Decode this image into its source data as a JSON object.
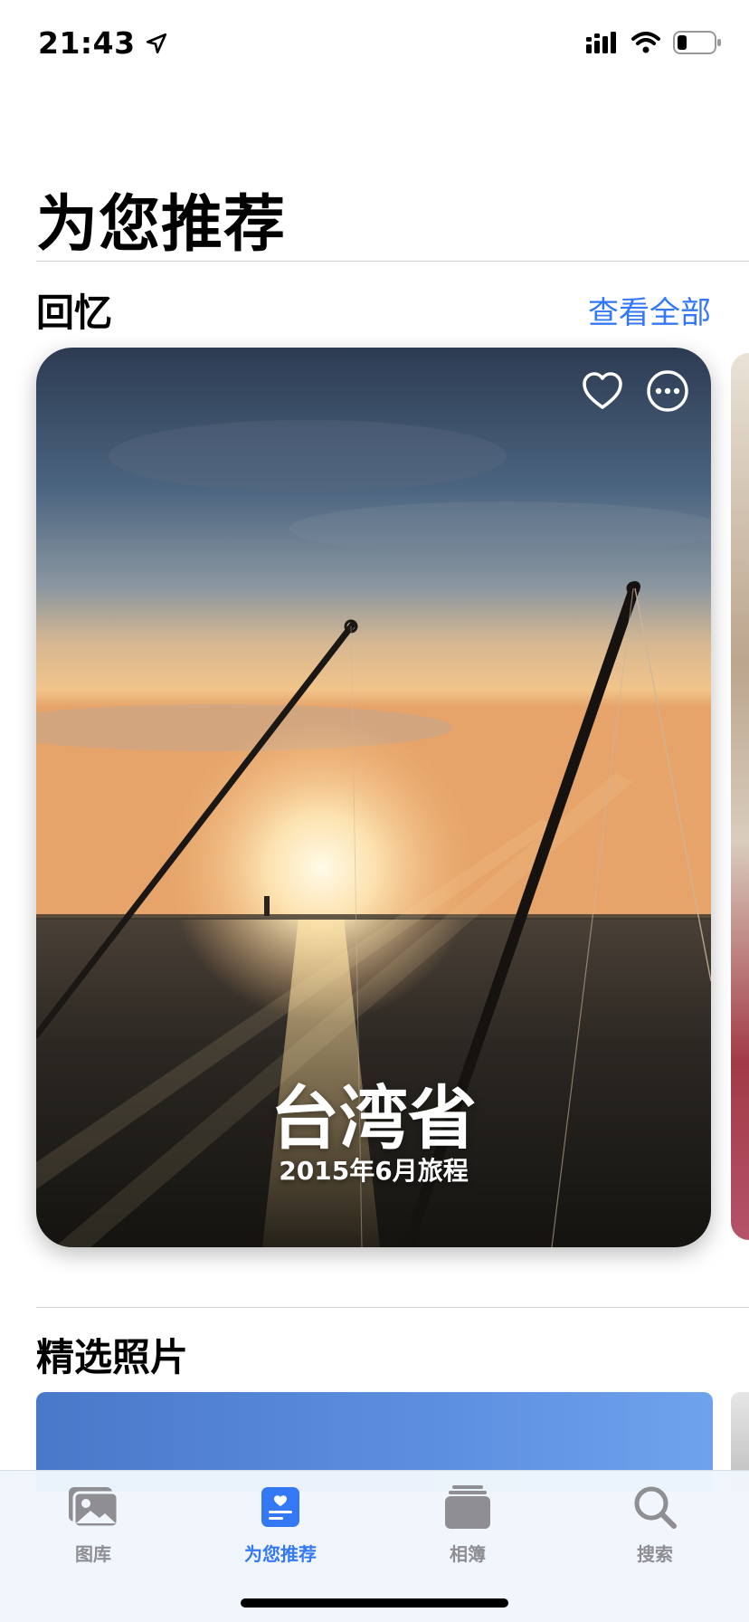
{
  "status_bar": {
    "time": "21:43"
  },
  "header": {
    "title": "为您推荐"
  },
  "memories": {
    "section_title": "回忆",
    "see_all_label": "查看全部",
    "card": {
      "title": "台湾省",
      "subtitle": "2015年6月旅程"
    }
  },
  "featured": {
    "section_title": "精选照片"
  },
  "tab_bar": {
    "tabs": [
      {
        "label": "图库",
        "icon": "photo-library-icon"
      },
      {
        "label": "为您推荐",
        "icon": "for-you-icon",
        "active": true
      },
      {
        "label": "相簿",
        "icon": "albums-icon"
      },
      {
        "label": "搜索",
        "icon": "search-icon"
      }
    ]
  },
  "colors": {
    "accent": "#3478f6",
    "inactive": "#8e8e93"
  }
}
